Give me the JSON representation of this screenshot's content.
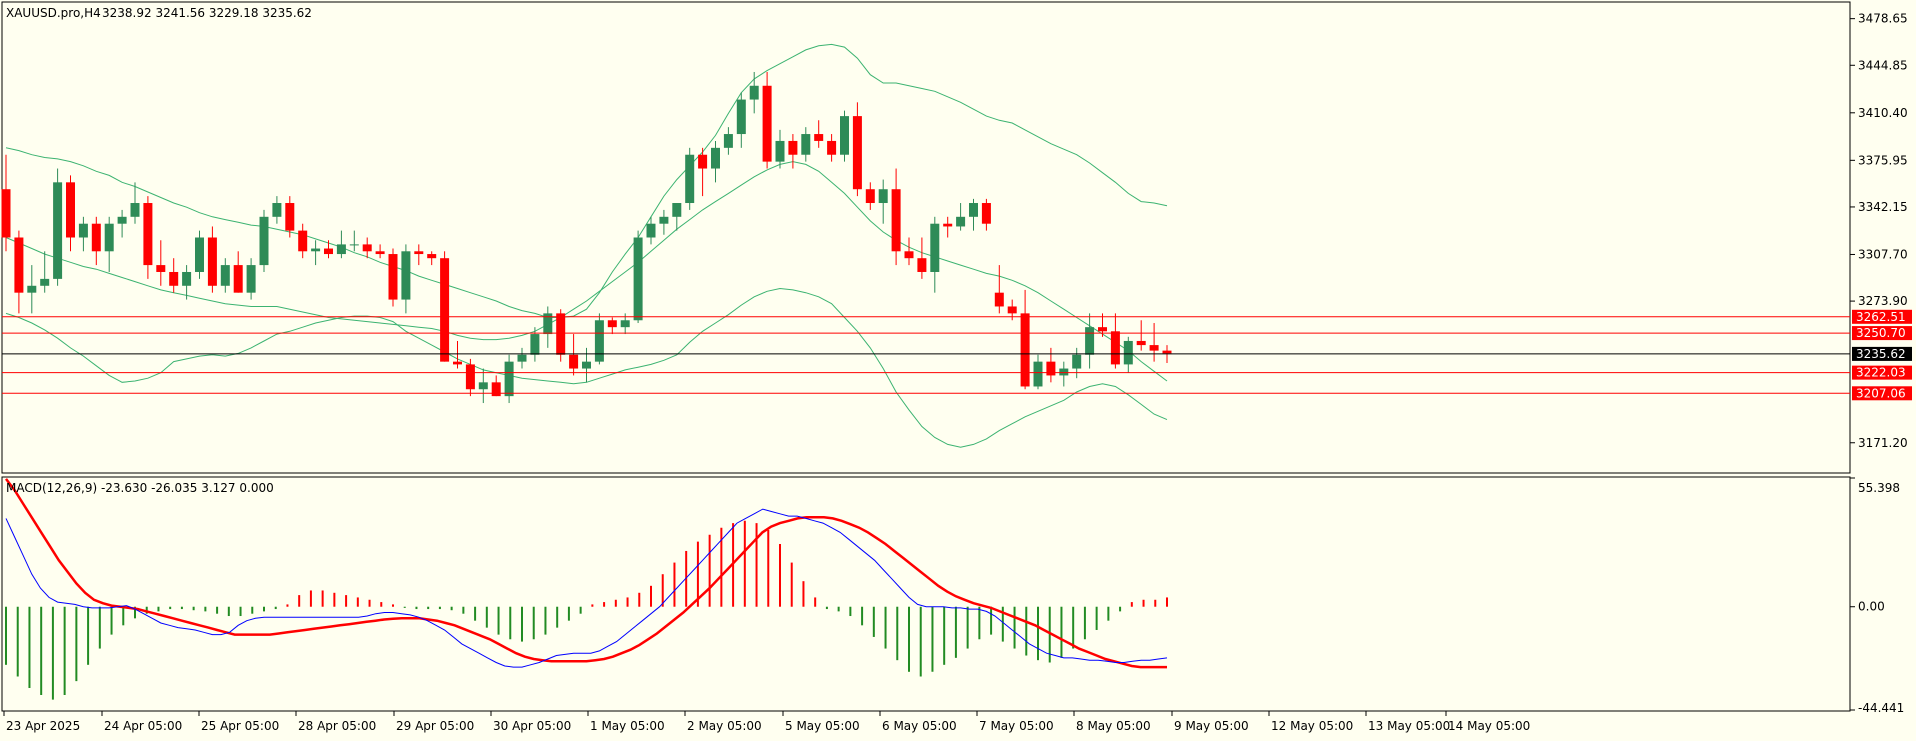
{
  "chart_data": [
    {
      "type": "candlestick",
      "title": "XAUUSD.pro,H4",
      "ohlc_label": "3238.92 3241.56 3229.18 3235.62",
      "ylim": [
        3150.0,
        3490.0
      ],
      "y_ticks": [
        "3478.65",
        "3444.85",
        "3410.40",
        "3375.95",
        "3342.15",
        "3307.70",
        "3273.90",
        "3171.20"
      ],
      "current_price": "3235.62",
      "levels": [
        "3262.51",
        "3250.70",
        "3222.03",
        "3207.06"
      ],
      "colors": {
        "bull": "#2e8b57",
        "bear": "#ff0000",
        "band": "#3cb371",
        "level": "#ff0000",
        "price_line": "#000000"
      },
      "candles": [
        [
          3355,
          3380,
          3310,
          3320
        ],
        [
          3320,
          3325,
          3265,
          3280
        ],
        [
          3280,
          3300,
          3265,
          3285
        ],
        [
          3285,
          3310,
          3280,
          3290
        ],
        [
          3290,
          3370,
          3285,
          3360
        ],
        [
          3360,
          3365,
          3310,
          3320
        ],
        [
          3320,
          3335,
          3310,
          3330
        ],
        [
          3330,
          3335,
          3300,
          3310
        ],
        [
          3310,
          3335,
          3295,
          3330
        ],
        [
          3330,
          3340,
          3320,
          3335
        ],
        [
          3335,
          3360,
          3330,
          3345
        ],
        [
          3345,
          3350,
          3290,
          3300
        ],
        [
          3300,
          3318,
          3285,
          3295
        ],
        [
          3295,
          3305,
          3280,
          3285
        ],
        [
          3285,
          3300,
          3275,
          3295
        ],
        [
          3295,
          3325,
          3290,
          3320
        ],
        [
          3320,
          3328,
          3280,
          3285
        ],
        [
          3285,
          3305,
          3280,
          3300
        ],
        [
          3300,
          3310,
          3280,
          3280
        ],
        [
          3280,
          3305,
          3275,
          3300
        ],
        [
          3300,
          3340,
          3295,
          3335
        ],
        [
          3335,
          3350,
          3330,
          3345
        ],
        [
          3345,
          3350,
          3320,
          3325
        ],
        [
          3325,
          3330,
          3305,
          3310
        ],
        [
          3310,
          3318,
          3300,
          3312
        ],
        [
          3312,
          3318,
          3305,
          3308
        ],
        [
          3308,
          3325,
          3305,
          3315
        ],
        [
          3315,
          3325,
          3310,
          3315
        ],
        [
          3315,
          3320,
          3305,
          3310
        ],
        [
          3310,
          3315,
          3305,
          3308
        ],
        [
          3308,
          3312,
          3270,
          3275
        ],
        [
          3275,
          3315,
          3265,
          3310
        ],
        [
          3310,
          3315,
          3300,
          3308
        ],
        [
          3308,
          3310,
          3300,
          3305
        ],
        [
          3305,
          3310,
          3230,
          3230
        ],
        [
          3230,
          3245,
          3225,
          3228
        ],
        [
          3228,
          3232,
          3205,
          3210
        ],
        [
          3210,
          3225,
          3200,
          3215
        ],
        [
          3215,
          3220,
          3205,
          3205
        ],
        [
          3205,
          3235,
          3200,
          3230
        ],
        [
          3230,
          3240,
          3225,
          3235
        ],
        [
          3235,
          3255,
          3230,
          3250
        ],
        [
          3250,
          3270,
          3240,
          3265
        ],
        [
          3265,
          3268,
          3230,
          3235
        ],
        [
          3235,
          3250,
          3220,
          3225
        ],
        [
          3225,
          3240,
          3215,
          3230
        ],
        [
          3230,
          3265,
          3228,
          3260
        ],
        [
          3260,
          3262,
          3250,
          3255
        ],
        [
          3255,
          3265,
          3250,
          3260
        ],
        [
          3260,
          3325,
          3258,
          3320
        ],
        [
          3320,
          3335,
          3315,
          3330
        ],
        [
          3330,
          3340,
          3322,
          3335
        ],
        [
          3335,
          3345,
          3325,
          3345
        ],
        [
          3345,
          3385,
          3340,
          3380
        ],
        [
          3380,
          3385,
          3350,
          3370
        ],
        [
          3370,
          3390,
          3360,
          3385
        ],
        [
          3385,
          3400,
          3380,
          3395
        ],
        [
          3395,
          3425,
          3385,
          3420
        ],
        [
          3420,
          3440,
          3410,
          3430
        ],
        [
          3430,
          3440,
          3370,
          3375
        ],
        [
          3375,
          3398,
          3370,
          3390
        ],
        [
          3390,
          3395,
          3370,
          3380
        ],
        [
          3380,
          3400,
          3375,
          3395
        ],
        [
          3395,
          3405,
          3385,
          3390
        ],
        [
          3390,
          3395,
          3375,
          3380
        ],
        [
          3380,
          3412,
          3375,
          3408
        ],
        [
          3408,
          3418,
          3350,
          3355
        ],
        [
          3355,
          3360,
          3340,
          3345
        ],
        [
          3345,
          3362,
          3330,
          3355
        ],
        [
          3355,
          3370,
          3300,
          3310
        ],
        [
          3310,
          3320,
          3300,
          3305
        ],
        [
          3305,
          3320,
          3290,
          3295
        ],
        [
          3295,
          3335,
          3280,
          3330
        ],
        [
          3330,
          3335,
          3320,
          3328
        ],
        [
          3328,
          3345,
          3325,
          3335
        ],
        [
          3335,
          3348,
          3325,
          3345
        ],
        [
          3345,
          3348,
          3325,
          3330
        ],
        [
          3280,
          3300,
          3265,
          3270
        ],
        [
          3270,
          3275,
          3260,
          3265
        ],
        [
          3265,
          3282,
          3210,
          3212
        ],
        [
          3212,
          3235,
          3210,
          3230
        ],
        [
          3230,
          3240,
          3215,
          3220
        ],
        [
          3220,
          3230,
          3212,
          3225
        ],
        [
          3225,
          3240,
          3218,
          3235
        ],
        [
          3235,
          3265,
          3225,
          3255
        ],
        [
          3255,
          3265,
          3248,
          3252
        ],
        [
          3252,
          3265,
          3225,
          3228
        ],
        [
          3228,
          3248,
          3222,
          3245
        ],
        [
          3245,
          3260,
          3238,
          3242
        ],
        [
          3242,
          3258,
          3230,
          3238
        ],
        [
          3238,
          3242,
          3229,
          3236
        ]
      ],
      "bands": {
        "upper": [
          3385,
          3383,
          3380,
          3378,
          3377,
          3375,
          3372,
          3368,
          3365,
          3360,
          3357,
          3353,
          3349,
          3345,
          3342,
          3338,
          3335,
          3333,
          3331,
          3329,
          3328,
          3326,
          3324,
          3322,
          3319,
          3316,
          3313,
          3309,
          3306,
          3302,
          3299,
          3296,
          3292,
          3289,
          3286,
          3283,
          3280,
          3277,
          3274,
          3270,
          3267,
          3265,
          3262,
          3262,
          3263,
          3268,
          3280,
          3295,
          3308,
          3320,
          3335,
          3350,
          3362,
          3372,
          3382,
          3394,
          3410,
          3425,
          3435,
          3441,
          3446,
          3451,
          3456,
          3459,
          3460,
          3458,
          3450,
          3438,
          3432,
          3432,
          3430,
          3428,
          3426,
          3422,
          3418,
          3413,
          3408,
          3405,
          3403,
          3398,
          3393,
          3388,
          3384,
          3380,
          3374,
          3367,
          3360,
          3352,
          3346,
          3345,
          3343
        ],
        "middle": [
          3320,
          3316,
          3312,
          3308,
          3305,
          3302,
          3299,
          3297,
          3294,
          3291,
          3288,
          3285,
          3282,
          3280,
          3278,
          3276,
          3274,
          3272,
          3271,
          3270,
          3270,
          3270,
          3268,
          3266,
          3264,
          3262,
          3261,
          3260,
          3259,
          3258,
          3257,
          3256,
          3255,
          3254,
          3252,
          3249,
          3247,
          3246,
          3246,
          3247,
          3249,
          3252,
          3257,
          3262,
          3268,
          3274,
          3281,
          3288,
          3295,
          3302,
          3310,
          3318,
          3326,
          3333,
          3340,
          3346,
          3352,
          3358,
          3364,
          3369,
          3373,
          3375,
          3373,
          3368,
          3360,
          3352,
          3342,
          3332,
          3324,
          3318,
          3313,
          3309,
          3306,
          3303,
          3300,
          3297,
          3294,
          3292,
          3289,
          3285,
          3280,
          3274,
          3268,
          3262,
          3256,
          3250,
          3244,
          3238,
          3230,
          3223,
          3216
        ],
        "lower": [
          3265,
          3262,
          3258,
          3253,
          3247,
          3240,
          3234,
          3227,
          3220,
          3215,
          3216,
          3218,
          3222,
          3230,
          3232,
          3234,
          3235,
          3234,
          3236,
          3240,
          3245,
          3250,
          3252,
          3255,
          3258,
          3260,
          3262,
          3263,
          3263,
          3262,
          3259,
          3252,
          3247,
          3242,
          3237,
          3232,
          3228,
          3224,
          3222,
          3220,
          3218,
          3217,
          3216,
          3215,
          3214,
          3215,
          3218,
          3221,
          3224,
          3226,
          3228,
          3231,
          3235,
          3244,
          3252,
          3258,
          3264,
          3271,
          3277,
          3281,
          3283,
          3282,
          3280,
          3277,
          3272,
          3262,
          3252,
          3240,
          3225,
          3208,
          3195,
          3183,
          3175,
          3170,
          3168,
          3170,
          3174,
          3180,
          3185,
          3190,
          3194,
          3198,
          3202,
          3208,
          3212,
          3214,
          3212,
          3206,
          3199,
          3192,
          3188
        ]
      }
    },
    {
      "type": "macd",
      "label": "MACD(12,26,9) -23.630 -26.035 3.127 0.000",
      "ylim": [
        -44.441,
        55.398
      ],
      "y_ticks": [
        "55.398",
        "0.00",
        "-44.441"
      ],
      "colors": {
        "macd": "#0000ff",
        "signal": "#ff0000",
        "hist_pos": "#ff0000",
        "hist_neg": "#228b22"
      },
      "macd": [
        38,
        30,
        22,
        14,
        8,
        4,
        2,
        1.5,
        1,
        0,
        -0.5,
        -0.5,
        -0.5,
        0,
        0.5,
        -1,
        -3,
        -5,
        -7,
        -8,
        -9,
        -9.5,
        -10,
        -11,
        -12,
        -12,
        -11,
        -8,
        -6,
        -5,
        -4.5,
        -4.5,
        -4.5,
        -4.5,
        -4.5,
        -4.5,
        -4.5,
        -4.5,
        -4.5,
        -4.5,
        -4.5,
        -4.5,
        -4,
        -3,
        -2.5,
        -2.5,
        -3,
        -3.5,
        -4.5,
        -6,
        -8,
        -10,
        -13,
        -16,
        -18,
        -20,
        -22,
        -24,
        -25.5,
        -26,
        -26,
        -25,
        -24,
        -22.5,
        -21,
        -20.5,
        -20,
        -20,
        -20,
        -19,
        -17,
        -15,
        -12,
        -9,
        -6,
        -3,
        0,
        4,
        8,
        12,
        16,
        20,
        24,
        28,
        32,
        36,
        38,
        40,
        42,
        41,
        40,
        39,
        39,
        38,
        37,
        36,
        34,
        32,
        29,
        26,
        23,
        20,
        16,
        12,
        8,
        4,
        1,
        0,
        0,
        0,
        -0.5,
        -0.5,
        -1,
        -1,
        -2,
        -4,
        -7,
        -10,
        -13,
        -16,
        -18,
        -20,
        -21,
        -22,
        -22,
        -22.5,
        -23,
        -23,
        -23.5,
        -24,
        -24,
        -23.5,
        -23,
        -23,
        -22.5,
        -22
      ],
      "signal": [
        55,
        50,
        44,
        38,
        32,
        26,
        20,
        15,
        10,
        6,
        3,
        1.5,
        0.5,
        0,
        -0.5,
        -1,
        -2,
        -3,
        -4,
        -5,
        -6,
        -7,
        -8,
        -9,
        -10,
        -11,
        -12,
        -12,
        -12,
        -12,
        -12,
        -11.5,
        -11,
        -10.5,
        -10,
        -9.5,
        -9,
        -8.5,
        -8,
        -7.5,
        -7,
        -6.5,
        -6,
        -5.5,
        -5.2,
        -5,
        -5,
        -5,
        -5.5,
        -6,
        -7,
        -8,
        -9.5,
        -11,
        -12.5,
        -14,
        -16,
        -18,
        -20,
        -21.5,
        -22.5,
        -23,
        -23.5,
        -23.5,
        -23.5,
        -23.5,
        -23.5,
        -23,
        -22.5,
        -21.5,
        -20,
        -18.5,
        -16.5,
        -14,
        -11.5,
        -8.5,
        -5.5,
        -2.5,
        1,
        4.5,
        8,
        12,
        16,
        20,
        24,
        28,
        32,
        34.5,
        36,
        37,
        38,
        38.5,
        38.5,
        38.5,
        38,
        37,
        35.5,
        34,
        32,
        29.5,
        27,
        24,
        21,
        18,
        15,
        12,
        9,
        6.5,
        4.5,
        3,
        1.5,
        0.5,
        -0.5,
        -2,
        -3.5,
        -5,
        -6.5,
        -8,
        -10,
        -12,
        -14,
        -16,
        -18,
        -19.5,
        -21,
        -22.5,
        -23.5,
        -24.5,
        -25.5,
        -26,
        -26,
        -26,
        -26
      ],
      "histogram": [
        -25,
        -30,
        -35,
        -38,
        -40,
        -38,
        -32,
        -25,
        -18,
        -12,
        -8,
        -5,
        -3,
        -2,
        -1,
        -1,
        -1.5,
        -2,
        -3,
        -4,
        -4,
        -3,
        -2,
        -1,
        1,
        5,
        7,
        7,
        6,
        5,
        4,
        3,
        2,
        1,
        -0.5,
        -1,
        -1,
        -1,
        -1.5,
        -3,
        -6,
        -9,
        -12,
        -14,
        -15,
        -14,
        -12,
        -9,
        -6,
        -3,
        1,
        2,
        3,
        4,
        6,
        9,
        14,
        19,
        24,
        28,
        31,
        34,
        36,
        37,
        36,
        33,
        27,
        19,
        11,
        4,
        -1,
        -2,
        -4,
        -8,
        -13,
        -18,
        -23,
        -28,
        -30,
        -28,
        -25,
        -22,
        -18,
        -14,
        -12,
        -15,
        -18,
        -21,
        -23,
        -24,
        -22,
        -18,
        -14,
        -10,
        -6,
        -2,
        2,
        3,
        3,
        4
      ]
    }
  ],
  "time_axis": [
    "23 Apr 2025",
    "24 Apr 05:00",
    "25 Apr 05:00",
    "28 Apr 05:00",
    "29 Apr 05:00",
    "30 Apr 05:00",
    "1 May 05:00",
    "2 May 05:00",
    "5 May 05:00",
    "6 May 05:00",
    "7 May 05:00",
    "8 May 05:00",
    "9 May 05:00",
    "12 May 05:00",
    "13 May 05:00",
    "14 May 05:00"
  ]
}
